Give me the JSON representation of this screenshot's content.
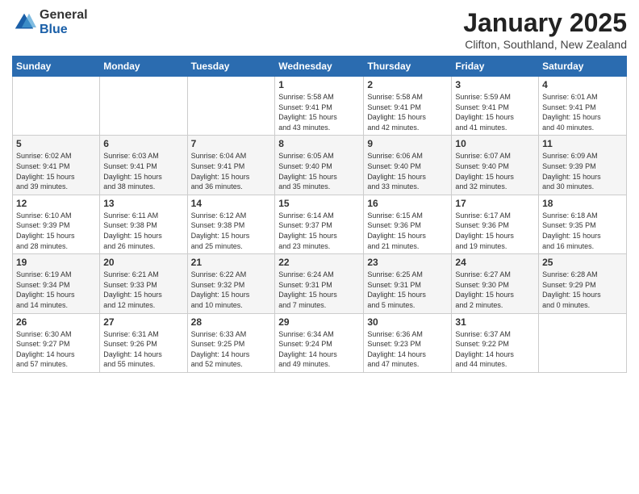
{
  "logo": {
    "general": "General",
    "blue": "Blue"
  },
  "title": "January 2025",
  "subtitle": "Clifton, Southland, New Zealand",
  "weekdays": [
    "Sunday",
    "Monday",
    "Tuesday",
    "Wednesday",
    "Thursday",
    "Friday",
    "Saturday"
  ],
  "weeks": [
    [
      {
        "day": "",
        "info": ""
      },
      {
        "day": "",
        "info": ""
      },
      {
        "day": "",
        "info": ""
      },
      {
        "day": "1",
        "info": "Sunrise: 5:58 AM\nSunset: 9:41 PM\nDaylight: 15 hours\nand 43 minutes."
      },
      {
        "day": "2",
        "info": "Sunrise: 5:58 AM\nSunset: 9:41 PM\nDaylight: 15 hours\nand 42 minutes."
      },
      {
        "day": "3",
        "info": "Sunrise: 5:59 AM\nSunset: 9:41 PM\nDaylight: 15 hours\nand 41 minutes."
      },
      {
        "day": "4",
        "info": "Sunrise: 6:01 AM\nSunset: 9:41 PM\nDaylight: 15 hours\nand 40 minutes."
      }
    ],
    [
      {
        "day": "5",
        "info": "Sunrise: 6:02 AM\nSunset: 9:41 PM\nDaylight: 15 hours\nand 39 minutes."
      },
      {
        "day": "6",
        "info": "Sunrise: 6:03 AM\nSunset: 9:41 PM\nDaylight: 15 hours\nand 38 minutes."
      },
      {
        "day": "7",
        "info": "Sunrise: 6:04 AM\nSunset: 9:41 PM\nDaylight: 15 hours\nand 36 minutes."
      },
      {
        "day": "8",
        "info": "Sunrise: 6:05 AM\nSunset: 9:40 PM\nDaylight: 15 hours\nand 35 minutes."
      },
      {
        "day": "9",
        "info": "Sunrise: 6:06 AM\nSunset: 9:40 PM\nDaylight: 15 hours\nand 33 minutes."
      },
      {
        "day": "10",
        "info": "Sunrise: 6:07 AM\nSunset: 9:40 PM\nDaylight: 15 hours\nand 32 minutes."
      },
      {
        "day": "11",
        "info": "Sunrise: 6:09 AM\nSunset: 9:39 PM\nDaylight: 15 hours\nand 30 minutes."
      }
    ],
    [
      {
        "day": "12",
        "info": "Sunrise: 6:10 AM\nSunset: 9:39 PM\nDaylight: 15 hours\nand 28 minutes."
      },
      {
        "day": "13",
        "info": "Sunrise: 6:11 AM\nSunset: 9:38 PM\nDaylight: 15 hours\nand 26 minutes."
      },
      {
        "day": "14",
        "info": "Sunrise: 6:12 AM\nSunset: 9:38 PM\nDaylight: 15 hours\nand 25 minutes."
      },
      {
        "day": "15",
        "info": "Sunrise: 6:14 AM\nSunset: 9:37 PM\nDaylight: 15 hours\nand 23 minutes."
      },
      {
        "day": "16",
        "info": "Sunrise: 6:15 AM\nSunset: 9:36 PM\nDaylight: 15 hours\nand 21 minutes."
      },
      {
        "day": "17",
        "info": "Sunrise: 6:17 AM\nSunset: 9:36 PM\nDaylight: 15 hours\nand 19 minutes."
      },
      {
        "day": "18",
        "info": "Sunrise: 6:18 AM\nSunset: 9:35 PM\nDaylight: 15 hours\nand 16 minutes."
      }
    ],
    [
      {
        "day": "19",
        "info": "Sunrise: 6:19 AM\nSunset: 9:34 PM\nDaylight: 15 hours\nand 14 minutes."
      },
      {
        "day": "20",
        "info": "Sunrise: 6:21 AM\nSunset: 9:33 PM\nDaylight: 15 hours\nand 12 minutes."
      },
      {
        "day": "21",
        "info": "Sunrise: 6:22 AM\nSunset: 9:32 PM\nDaylight: 15 hours\nand 10 minutes."
      },
      {
        "day": "22",
        "info": "Sunrise: 6:24 AM\nSunset: 9:31 PM\nDaylight: 15 hours\nand 7 minutes."
      },
      {
        "day": "23",
        "info": "Sunrise: 6:25 AM\nSunset: 9:31 PM\nDaylight: 15 hours\nand 5 minutes."
      },
      {
        "day": "24",
        "info": "Sunrise: 6:27 AM\nSunset: 9:30 PM\nDaylight: 15 hours\nand 2 minutes."
      },
      {
        "day": "25",
        "info": "Sunrise: 6:28 AM\nSunset: 9:29 PM\nDaylight: 15 hours\nand 0 minutes."
      }
    ],
    [
      {
        "day": "26",
        "info": "Sunrise: 6:30 AM\nSunset: 9:27 PM\nDaylight: 14 hours\nand 57 minutes."
      },
      {
        "day": "27",
        "info": "Sunrise: 6:31 AM\nSunset: 9:26 PM\nDaylight: 14 hours\nand 55 minutes."
      },
      {
        "day": "28",
        "info": "Sunrise: 6:33 AM\nSunset: 9:25 PM\nDaylight: 14 hours\nand 52 minutes."
      },
      {
        "day": "29",
        "info": "Sunrise: 6:34 AM\nSunset: 9:24 PM\nDaylight: 14 hours\nand 49 minutes."
      },
      {
        "day": "30",
        "info": "Sunrise: 6:36 AM\nSunset: 9:23 PM\nDaylight: 14 hours\nand 47 minutes."
      },
      {
        "day": "31",
        "info": "Sunrise: 6:37 AM\nSunset: 9:22 PM\nDaylight: 14 hours\nand 44 minutes."
      },
      {
        "day": "",
        "info": ""
      }
    ]
  ]
}
